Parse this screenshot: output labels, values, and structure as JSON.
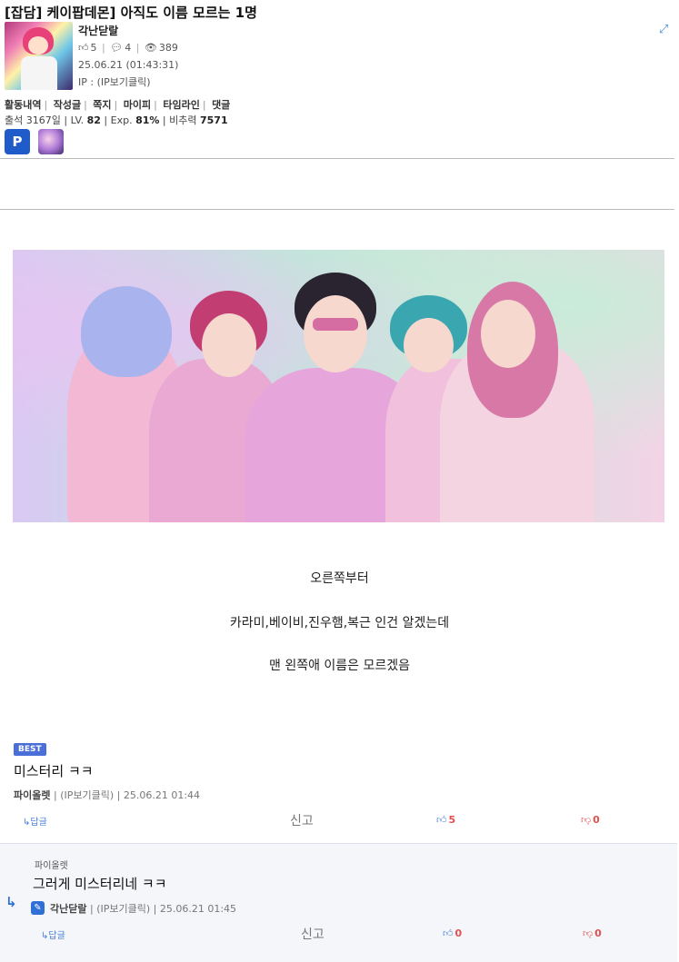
{
  "post": {
    "title": "[잡담] 케이팝데몬] 아직도 이름 모르는 1명",
    "author": "각난닫랄",
    "likes": "5",
    "comments": "4",
    "views": "389",
    "date": "25.06.21 (01:43:31)",
    "ip": "IP : (IP보기클릭)"
  },
  "profile_links": [
    "활동내역",
    "작성글",
    "쪽지",
    "마이피",
    "타임라인",
    "댓글"
  ],
  "profile_meta": {
    "attend_label": "출석",
    "attend_value": "3167일",
    "lv_label": "LV.",
    "lv_value": "82",
    "exp_label": "Exp.",
    "exp_value": "81%",
    "power_label": "비추력",
    "power_value": "7571"
  },
  "badge1_text": "P",
  "body_lines": [
    "오른쪽부터",
    "카라미,베이비,진우햄,복근 인건 알겠는데",
    "맨 왼쪽애 이름은 모르겠음"
  ],
  "comment1": {
    "badge": "BEST",
    "text": "미스터리 ㅋㅋ",
    "author": "파이올렛",
    "ip": "(IP보기클릭)",
    "date": "25.06.21 01:44",
    "reply_label": "답글",
    "report_label": "신고",
    "likes": "5",
    "dislikes": "0"
  },
  "comment2": {
    "reply_to": "파이올렛",
    "text": "그러게 미스터리네 ㅋㅋ",
    "author": "각난닫랄",
    "ip": "(IP보기클릭)",
    "date": "25.06.21 01:45",
    "reply_label": "답글",
    "report_label": "신고",
    "likes": "0",
    "dislikes": "0"
  },
  "colors": {
    "accent": "#4a7fd8",
    "down": "#e05050",
    "best_badge": "#4a6fd8"
  }
}
